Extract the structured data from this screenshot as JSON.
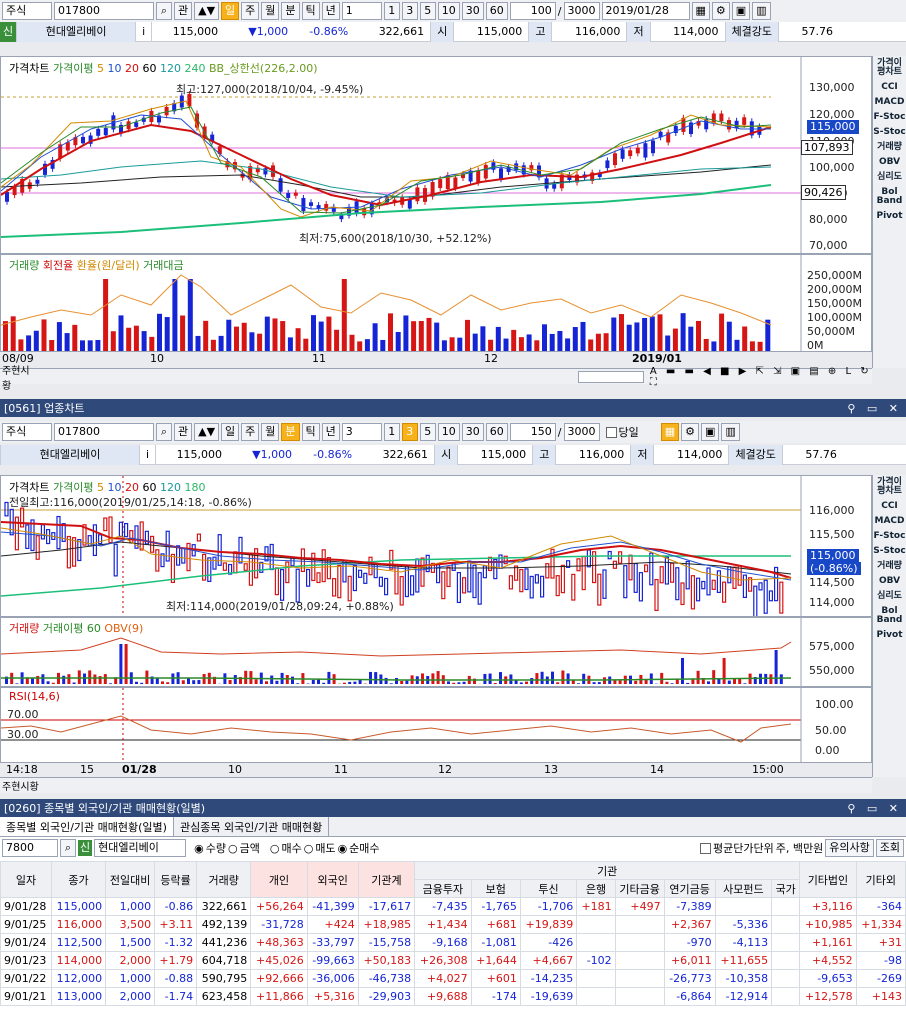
{
  "win1": {
    "toolbar": {
      "type": "주식",
      "code": "017800",
      "btn_gwan": "관",
      "btn_il": "일",
      "btn_ju": "주",
      "btn_wol": "월",
      "btn_bun": "분",
      "btn_tik": "틱",
      "btn_nyeon": "년",
      "period": "1",
      "p1": "1",
      "p3": "3",
      "p5": "5",
      "p10": "10",
      "p30": "30",
      "p60": "60",
      "count": "100",
      "sep": "/",
      "total": "3000",
      "date": "2019/01/28"
    },
    "quote": {
      "tag": "신",
      "name": "현대엘리베이",
      "info": "i",
      "price": "115,000",
      "change": "▼1,000",
      "pct": "-0.86%",
      "volume": "322,661",
      "open_l": "시",
      "open": "115,000",
      "high_l": "고",
      "high": "116,000",
      "low_l": "저",
      "low": "114,000",
      "str_l": "체결강도",
      "strength": "57.76"
    },
    "price_legend": {
      "a": "가격차트",
      "b": "가격이평",
      "m5": "5",
      "m10": "10",
      "m20": "20",
      "m60": "60",
      "m120": "120",
      "m240": "240",
      "bb": "BB_상한선(226,2.00)"
    },
    "high_note": "최고:127,000(2018/10/04, -9.45%)",
    "low_note": "최저:75,600(2018/10/30, +52.12%)",
    "price_axis": [
      "130,000",
      "120,000",
      "110,000",
      "100,000",
      "90,000",
      "80,000",
      "70,000"
    ],
    "price_tags": {
      "cur": "115,000",
      "ma": "107,893",
      "bb": "90,426"
    },
    "vol_legend": {
      "a": "거래량",
      "b": "회전율",
      "c": "환율(원/달러)",
      "d": "거래대금"
    },
    "vol_axis": [
      "250,000M",
      "200,000M",
      "150,000M",
      "100,000M",
      "50,000M",
      "0M"
    ],
    "x_labels": [
      "08/09",
      "10",
      "11",
      "12",
      "2019/01"
    ],
    "bottom": "주현시황",
    "side": [
      "가격이평차트",
      "CCI",
      "MACD",
      "F-Stoc",
      "S-Stoc",
      "거래량",
      "OBV",
      "심리도",
      "Bol Band",
      "Pivot"
    ]
  },
  "win2": {
    "title": "[0561] 업종차트",
    "toolbar": {
      "type": "주식",
      "code": "017800",
      "btn_gwan": "관",
      "btn_il": "일",
      "btn_ju": "주",
      "btn_wol": "월",
      "btn_bun": "분",
      "btn_tik": "틱",
      "btn_nyeon": "년",
      "period": "3",
      "p1": "1",
      "p3": "3",
      "p5": "5",
      "p10": "10",
      "p30": "30",
      "p60": "60",
      "count": "150",
      "sep": "/",
      "total": "3000",
      "today": "당일"
    },
    "quote": {
      "name": "현대엘리베이",
      "info": "i",
      "price": "115,000",
      "change": "▼1,000",
      "pct": "-0.86%",
      "volume": "322,661",
      "open_l": "시",
      "open": "115,000",
      "high_l": "고",
      "high": "116,000",
      "low_l": "저",
      "low": "114,000",
      "str_l": "체결강도",
      "strength": "57.76"
    },
    "price_legend": {
      "a": "가격차트",
      "b": "가격이평",
      "m5": "5",
      "m10": "10",
      "m20": "20",
      "m60": "60",
      "m120": "120",
      "m180": "180"
    },
    "high_note": "전일최고:116,000(2019/01/25,14:18, -0.86%)",
    "low_note": "최저:114,000(2019/01/28,09:24, +0.88%)",
    "price_axis": [
      "116,000",
      "115,500",
      "114,500",
      "114,000"
    ],
    "price_tag": "115,000",
    "price_tag2": "(-0.86%)",
    "vol_legend": {
      "a": "거래량",
      "b": "거래이평",
      "c": "60",
      "d": "OBV(9)"
    },
    "vol_axis": [
      "575,000",
      "550,000"
    ],
    "rsi_legend": "RSI(14,6)",
    "rsi_axis": [
      "100.00",
      "50.00",
      "0.00"
    ],
    "rsi_levels": [
      "70.00",
      "30.00"
    ],
    "x_labels": [
      "14:18",
      "15",
      "01/28",
      "10",
      "11",
      "12",
      "13",
      "14",
      "15:00"
    ],
    "bottom": "주현시황",
    "side": [
      "가격이평차트",
      "CCI",
      "MACD",
      "F-Stoc",
      "S-Stoc",
      "거래량",
      "OBV",
      "심리도",
      "Bol Band",
      "Pivot"
    ]
  },
  "win3": {
    "title": "[0260] 종목별 외국인/기관 매매현황(일별)",
    "tab1": "종목별 외국인/기관 매매현황(일별)",
    "tab2": "관심종목 외국인/기관 매매현황",
    "code": "7800",
    "tag": "신",
    "name": "현대엘리베이",
    "r_qty": "수량",
    "r_amt": "금액",
    "r_buy": "매수",
    "r_sell": "매도",
    "r_net": "순매수",
    "avg_chk": "평균단가단위",
    "unit": "주, 백만원",
    "btn_notice": "유의사항",
    "btn_query": "조회",
    "headers": [
      "일자",
      "종가",
      "전일대비",
      "등락률",
      "거래량",
      "개인",
      "외국인",
      "기관계",
      "금융투자",
      "보험",
      "투신",
      "은행",
      "기타금융",
      "연기금등",
      "사모펀드",
      "국가",
      "기타법인",
      "기타외"
    ],
    "group": "기관",
    "rows": [
      [
        "9/01/28",
        "115,000",
        "1,000",
        "-0.86",
        "322,661",
        "+56,264",
        "-41,399",
        "-17,617",
        "-7,435",
        "-1,765",
        "-1,706",
        "+181",
        "+497",
        "-7,389",
        "",
        "",
        "+3,116",
        "-364"
      ],
      [
        "9/01/25",
        "116,000",
        "3,500",
        "+3.11",
        "492,139",
        "-31,728",
        "+424",
        "+18,985",
        "+1,434",
        "+681",
        "+19,839",
        "",
        "",
        "+2,367",
        "-5,336",
        "",
        "+10,985",
        "+1,334"
      ],
      [
        "9/01/24",
        "112,500",
        "1,500",
        "-1.32",
        "441,236",
        "+48,363",
        "-33,797",
        "-15,758",
        "-9,168",
        "-1,081",
        "-426",
        "",
        "",
        "-970",
        "-4,113",
        "",
        "+1,161",
        "+31"
      ],
      [
        "9/01/23",
        "114,000",
        "2,000",
        "+1.79",
        "604,718",
        "+45,026",
        "-99,663",
        "+50,183",
        "+26,308",
        "+1,644",
        "+4,667",
        "-102",
        "",
        "+6,011",
        "+11,655",
        "",
        "+4,552",
        "-98"
      ],
      [
        "9/01/22",
        "112,000",
        "1,000",
        "-0.88",
        "590,795",
        "+92,666",
        "-36,006",
        "-46,738",
        "+4,027",
        "+601",
        "-14,235",
        "",
        "",
        "-26,773",
        "-10,358",
        "",
        "-9,653",
        "-269"
      ],
      [
        "9/01/21",
        "113,000",
        "2,000",
        "-1.74",
        "623,458",
        "+11,866",
        "+5,316",
        "-29,903",
        "+9,688",
        "-174",
        "-19,639",
        "",
        "",
        "-6,864",
        "-12,914",
        "",
        "+12,578",
        "+143"
      ]
    ],
    "change_dir": [
      "dn",
      "up",
      "dn",
      "up",
      "dn",
      "dn"
    ]
  }
}
